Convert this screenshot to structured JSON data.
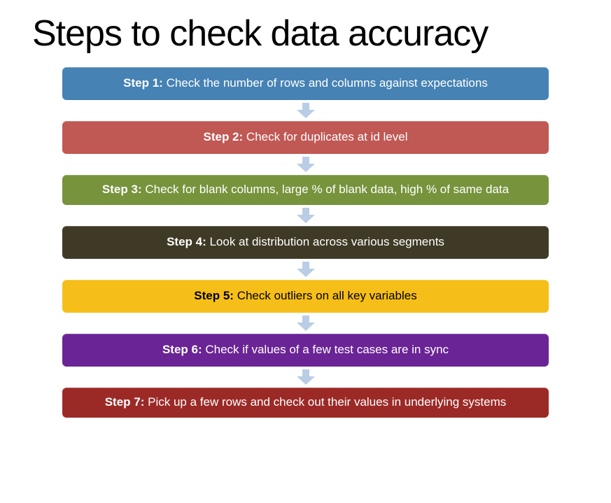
{
  "title": "Steps to check data accuracy",
  "arrow_color": "#b9cde5",
  "steps": [
    {
      "label": "Step 1:",
      "text": " Check the number of rows and columns against expectations",
      "bg": "#4682b4",
      "dark": false
    },
    {
      "label": "Step 2:",
      "text": " Check for duplicates at id level",
      "bg": "#c05854",
      "dark": false
    },
    {
      "label": "Step 3:",
      "text": " Check for blank columns, large % of blank data, high % of same data",
      "bg": "#77933c",
      "dark": false
    },
    {
      "label": "Step 4:",
      "text": " Look at distribution across various segments",
      "bg": "#3f3a25",
      "dark": false
    },
    {
      "label": "Step 5:",
      "text": " Check outliers on all key variables",
      "bg": "#f6be18",
      "dark": true
    },
    {
      "label": "Step 6:",
      "text": " Check if values of a few test cases are in sync",
      "bg": "#6a2495",
      "dark": false
    },
    {
      "label": "Step 7:",
      "text": " Pick up a few rows and check out their values in underlying systems",
      "bg": "#9b2a27",
      "dark": false
    }
  ]
}
